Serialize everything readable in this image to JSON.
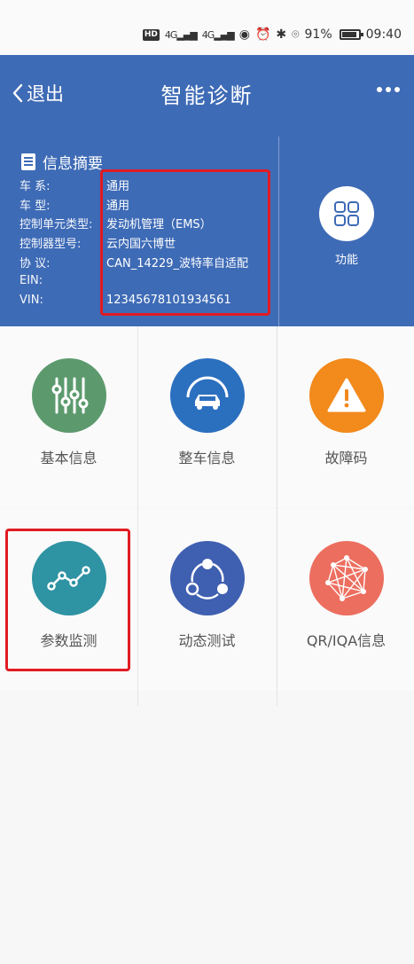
{
  "status_bar": {
    "chip": "HD",
    "signal_1": "4G",
    "signal_2": "4G",
    "battery_pct": "91%",
    "battery_level": 0.91,
    "time": "09:40"
  },
  "header": {
    "back_label": "退出",
    "title": "智能诊断"
  },
  "info": {
    "title": "信息摘要",
    "rows": [
      {
        "key": "车 系:",
        "value": "通用"
      },
      {
        "key": "车 型:",
        "value": "通用"
      },
      {
        "key": "控制单元类型:",
        "value": "发动机管理（EMS）"
      },
      {
        "key": "控制器型号:",
        "value": "云内国六博世"
      },
      {
        "key": "协 议:",
        "value": "CAN_14229_波特率自适配"
      },
      {
        "key": "EIN:",
        "value": ""
      },
      {
        "key": "VIN:",
        "value": "12345678101934561"
      }
    ],
    "function_label": "功能"
  },
  "tiles": [
    {
      "label": "基本信息",
      "color": "#5c9a6e"
    },
    {
      "label": "整车信息",
      "color": "#2b6fbf"
    },
    {
      "label": "故障码",
      "color": "#f28a1c"
    },
    {
      "label": "参数监测",
      "color": "#2e93a3"
    },
    {
      "label": "动态测试",
      "color": "#3f5fb0"
    },
    {
      "label": "QR/IQA信息",
      "color": "#ec6e5f"
    }
  ]
}
